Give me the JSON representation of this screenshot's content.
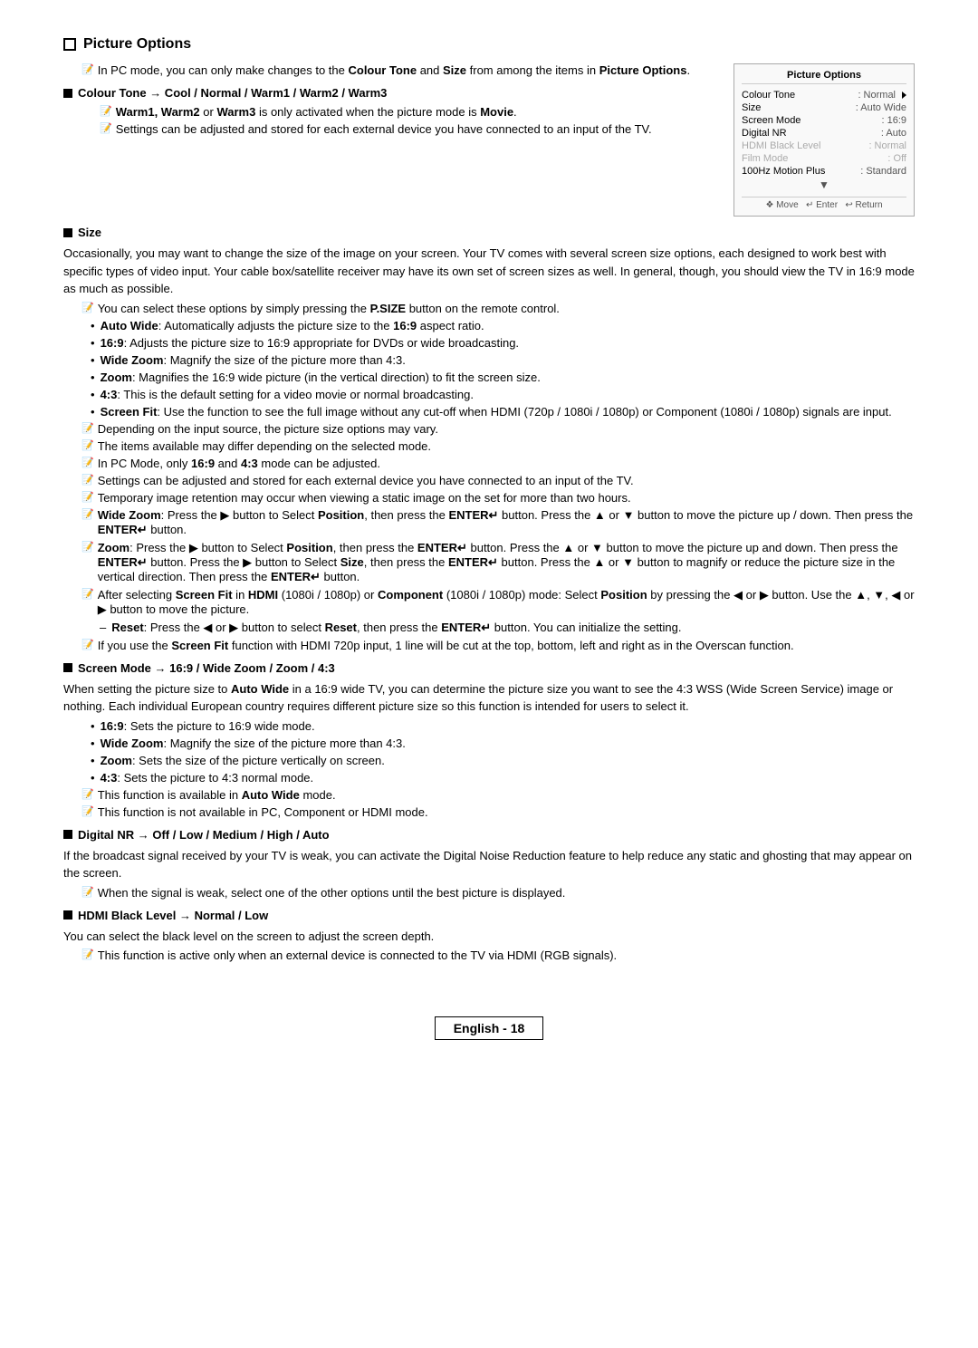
{
  "page": {
    "title": "Picture Options",
    "footer_label": "English - 18"
  },
  "picture_options_box": {
    "title": "Picture Options",
    "rows": [
      {
        "label": "Colour Tone",
        "value": ": Normal",
        "has_arrow": true,
        "style": "normal"
      },
      {
        "label": "Size",
        "value": ": Auto Wide",
        "has_arrow": false,
        "style": "normal"
      },
      {
        "label": "Screen Mode",
        "value": ": 16:9",
        "has_arrow": false,
        "style": "normal"
      },
      {
        "label": "Digital NR",
        "value": ": Auto",
        "has_arrow": false,
        "style": "normal"
      },
      {
        "label": "HDMI Black Level",
        "value": ": Normal",
        "has_arrow": false,
        "style": "greyed"
      },
      {
        "label": "Film Mode",
        "value": ": Off",
        "has_arrow": false,
        "style": "greyed"
      },
      {
        "label": "100Hz Motion Plus",
        "value": ": Standard",
        "has_arrow": false,
        "style": "normal"
      }
    ],
    "nav": "❖ Move  ↵ Enter  ↩ Return"
  },
  "content": {
    "intro_notes": [
      "In PC mode, you can only make changes to the Colour Tone and Size from among the items in Picture Options."
    ],
    "colour_tone_section": {
      "header": "Colour Tone → Cool / Normal / Warm1 / Warm2 / Warm3",
      "notes": [
        "Warm1, Warm2 or Warm3 is only activated when the picture mode is Movie.",
        "Settings can be adjusted and stored for each external device you have connected to an input of the TV."
      ]
    },
    "size_section": {
      "header": "Size",
      "intro_para": "Occasionally, you may want to change the size of the image on your screen. Your TV comes with several screen size options, each designed to work best with specific types of video input. Your cable box/satellite receiver may have its own set of screen sizes as well. In general, though, you should view the TV in 16:9 mode as much as possible.",
      "note_psize": "You can select these options by simply pressing the P.SIZE button on the remote control.",
      "bullets": [
        "Auto Wide: Automatically adjusts the picture size to the 16:9 aspect ratio.",
        "16:9: Adjusts the picture size to 16:9 appropriate for DVDs or wide broadcasting.",
        "Wide Zoom: Magnify the size of the picture more than 4:3.",
        "Zoom: Magnifies the 16:9 wide picture (in the vertical direction) to fit the screen size.",
        "4:3: This is the default setting for a video movie or normal broadcasting.",
        "Screen Fit: Use the function to see the full image without any cut-off when HDMI (720p / 1080i / 1080p) or Component (1080i / 1080p) signals are input."
      ],
      "bottom_notes": [
        "Depending on the input source, the picture size options may vary.",
        "The items available may differ depending on the selected mode.",
        "In PC Mode, only 16:9 and 4:3 mode can be adjusted.",
        "Settings can be adjusted and stored for each external device you have connected to an input of the TV.",
        "Temporary image retention may occur when viewing a static image on the set for more than two hours.",
        "Wide Zoom: Press the ▶ button to Select Position, then press the ENTER↵ button. Press the ▲ or ▼ button to move the picture up / down. Then press the ENTER↵ button.",
        "Zoom: Press the ▶ button to Select Position, then press the ENTER↵ button. Press the ▲ or ▼ button to move the picture up and down. Then press the ENTER↵ button. Press the ▶ button to Select Size, then press the ENTER↵ button. Press the ▲ or ▼ button to magnify or reduce the picture size in the vertical direction. Then press the ENTER↵ button.",
        "After selecting Screen Fit in HDMI (1080i / 1080p) or Component (1080i / 1080p) mode: Select Position by pressing the ◀ or ▶ button. Use the ▲, ▼, ◀ or ▶ button to move the picture.",
        "If you use the Screen Fit function with HDMI 720p input, 1 line will be cut at the top, bottom, left and right as in the Overscan function."
      ],
      "dash_note": "Reset: Press the ◀ or ▶ button to select Reset, then press the ENTER↵ button. You can initialize the setting."
    },
    "screen_mode_section": {
      "header": "Screen Mode → 16:9 / Wide Zoom / Zoom / 4:3",
      "intro": "When setting the picture size to Auto Wide in a 16:9 wide TV, you can determine the picture size you want to see the 4:3 WSS (Wide Screen Service) image or nothing. Each individual European country requires different picture size so this function is intended for users to select it.",
      "bullets": [
        "16:9: Sets the picture to 16:9 wide mode.",
        "Wide Zoom: Magnify the size of the picture more than 4:3.",
        "Zoom: Sets the size of the picture vertically on screen.",
        "4:3: Sets the picture to 4:3 normal mode."
      ],
      "notes": [
        "This function is available in Auto Wide mode.",
        "This function is not available in PC, Component or HDMI mode."
      ]
    },
    "digital_nr_section": {
      "header": "Digital NR → Off / Low / Medium / High / Auto",
      "intro": "If the broadcast signal received by your TV is weak, you can activate the Digital Noise Reduction feature to help reduce any static and ghosting that may appear on the screen.",
      "note": "When the signal is weak, select one of the other options until the best picture is displayed."
    },
    "hdmi_black_section": {
      "header": "HDMI Black Level → Normal / Low",
      "intro": "You can select the black level on the screen to adjust the screen depth.",
      "note": "This function is active only when an external device is connected to the TV via HDMI (RGB signals)."
    }
  }
}
